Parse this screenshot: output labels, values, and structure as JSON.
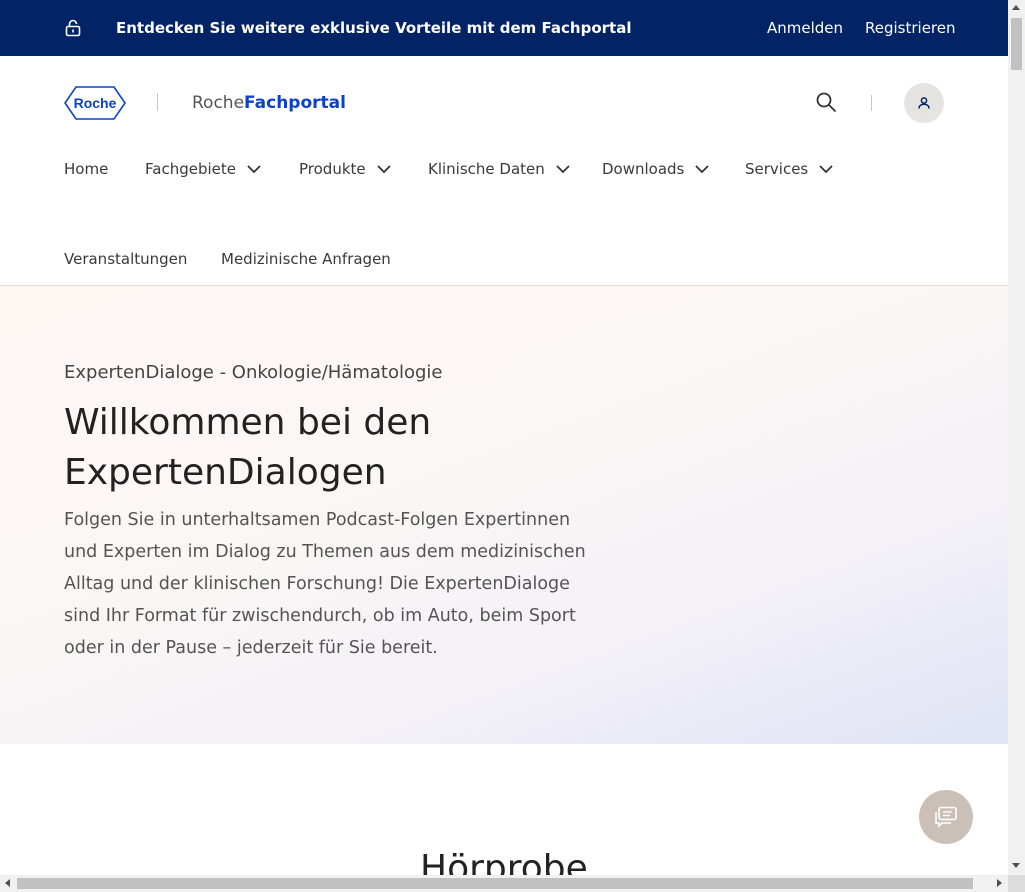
{
  "topbar": {
    "promo_text": "Entdecken Sie weitere exklusive Vorteile mit dem Fachportal",
    "login_label": "Anmelden",
    "register_label": "Registrieren",
    "background_color": "#022366",
    "icon": "lock-open-icon"
  },
  "header": {
    "logo_text": "Roche",
    "brand_prefix": "Roche",
    "brand_suffix": "Fachportal",
    "brand_color": "#0b41cd",
    "search_icon": "search-icon",
    "user_icon": "user-icon"
  },
  "nav": {
    "items": [
      {
        "label": "Home",
        "has_dropdown": false
      },
      {
        "label": "Fachgebiete",
        "has_dropdown": true
      },
      {
        "label": "Produkte",
        "has_dropdown": true
      },
      {
        "label": "Klinische Daten",
        "has_dropdown": true
      },
      {
        "label": "Downloads",
        "has_dropdown": true
      },
      {
        "label": "Services",
        "has_dropdown": true
      },
      {
        "label": "Veranstaltungen",
        "has_dropdown": false
      },
      {
        "label": "Medizinische Anfragen",
        "has_dropdown": false
      }
    ]
  },
  "hero": {
    "eyebrow": "ExpertenDialoge - Onkologie/Hämatologie",
    "title": "Willkommen bei den ExpertenDialogen",
    "text": "Folgen Sie in unterhaltsamen Podcast-Folgen Expertinnen und Experten im Dialog zu Themen aus dem medizinischen Alltag und der klinischen Forschung! Die ExpertenDialoge sind Ihr Format für zwischendurch, ob im Auto, beim Sport oder in der Pause – jederzeit für Sie bereit."
  },
  "section": {
    "title": "Hörprobe"
  },
  "chat": {
    "icon": "chat-icon"
  }
}
